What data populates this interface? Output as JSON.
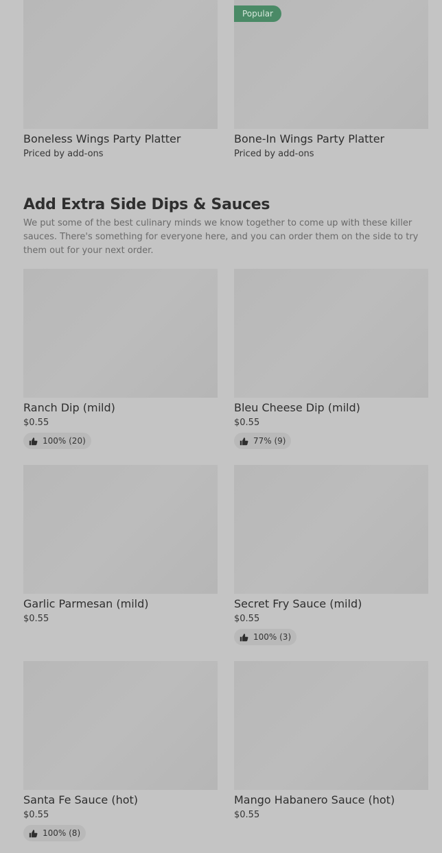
{
  "top_items": [
    {
      "name": "Boneless Wings Party Platter",
      "price": "Priced by add-ons",
      "badge": ""
    },
    {
      "name": "Bone-In Wings Party Platter",
      "price": "Priced by add-ons",
      "badge": "Popular"
    }
  ],
  "section": {
    "title": "Add Extra Side Dips & Sauces",
    "description": "We put some of the best culinary minds we know together to come up with these killer sauces. There's something for everyone here, and you can order them on the side to try them out for your next order."
  },
  "sauce_items": [
    {
      "name": "Ranch Dip (mild)",
      "price": "$0.55",
      "rating": "100% (20)"
    },
    {
      "name": "Bleu Cheese Dip (mild)",
      "price": "$0.55",
      "rating": "77% (9)"
    },
    {
      "name": "Garlic Parmesan (mild)",
      "price": "$0.55",
      "rating": ""
    },
    {
      "name": "Secret Fry Sauce (mild)",
      "price": "$0.55",
      "rating": "100% (3)"
    },
    {
      "name": "Santa Fe Sauce (hot)",
      "price": "$0.55",
      "rating": "100% (8)"
    },
    {
      "name": "Mango Habanero Sauce (hot)",
      "price": "$0.55",
      "rating": ""
    }
  ],
  "icons": {
    "rating": "thumbs-up-icon"
  },
  "colors": {
    "badge": "#4a8a66",
    "overlay": "#c4c4c4"
  }
}
